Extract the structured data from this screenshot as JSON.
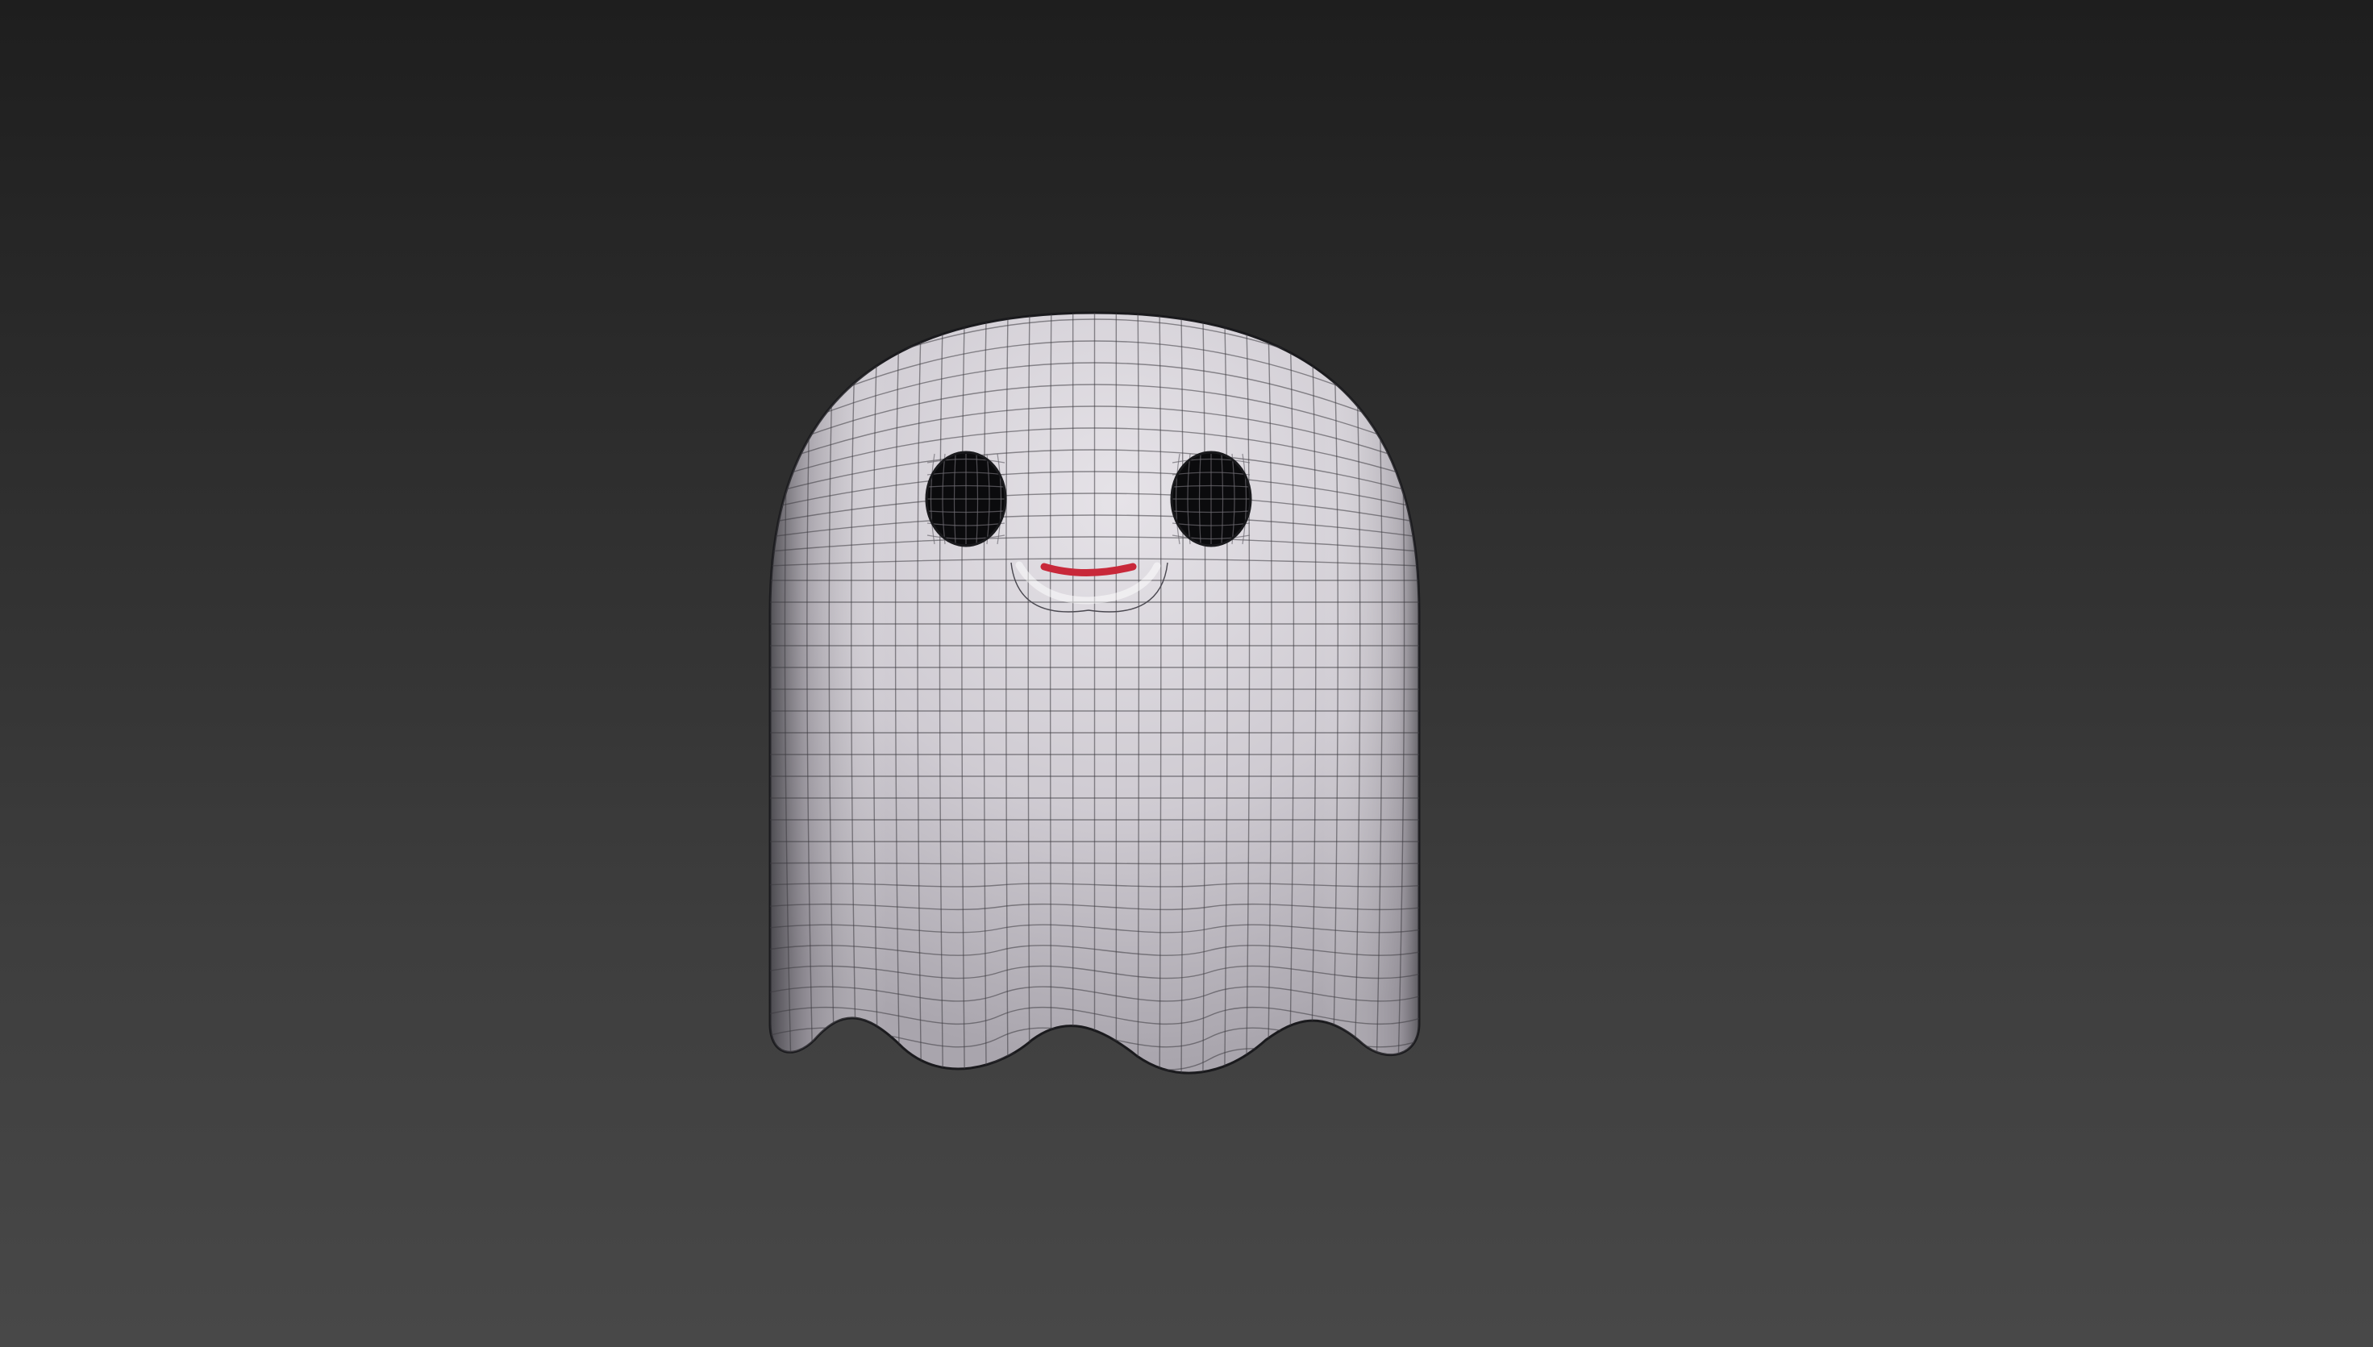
{
  "viewport": {
    "name": "3d-viewport",
    "background_top": "#1e1e1e",
    "background_bottom": "#484848"
  },
  "model": {
    "name": "ghost",
    "display_mode": "shaded-with-wireframe",
    "colors": {
      "body": "#cfcbd2",
      "body_highlight": "#e6e3e8",
      "body_shadow": "#8e8a92",
      "wire": "#3c3a40",
      "eyes": "#0b0b0d",
      "mouth": "#c8283a"
    }
  }
}
